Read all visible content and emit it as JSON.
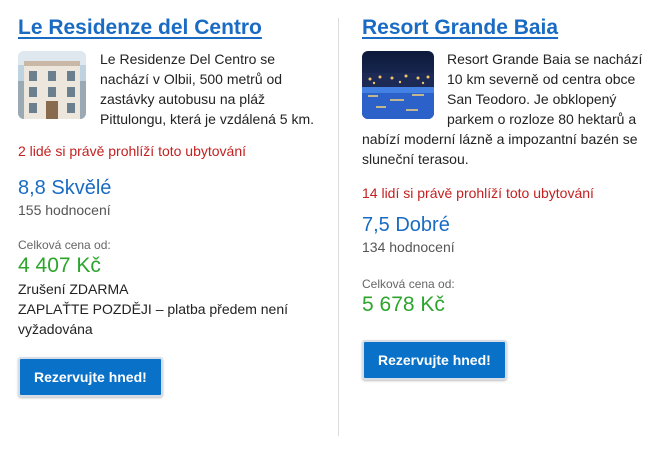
{
  "button_color": "#0a71c9",
  "link_color": "#1a6bc4",
  "viewer_color": "#c42020",
  "price_color": "#2da52d",
  "hotels": [
    {
      "name": "Le Residenze del Centro",
      "description": "Le Residenze Del Centro se nachází v Olbii, 500 metrů od zastávky autobusu na pláž Pittulongu, která je vzdálená 5 km.",
      "viewers": "2 lidé si právě prohlíží toto ubytování",
      "score": "8,8 Skvělé",
      "reviews": "155 hodnocení",
      "price_label": "Celková cena od:",
      "price": "4 407 Kč",
      "cancellation": "Zrušení ZDARMA",
      "payment": "ZAPLAŤTE POZDĚJI – platba předem není vyžadována",
      "button": "Rezervujte hned!"
    },
    {
      "name": "Resort Grande Baia",
      "description": "Resort Grande Baia se nachází 10 km severně od centra obce San Teodoro. Je obklopený parkem o rozloze 80 hektarů a nabízí moderní lázně a impozantní bazén se sluneční terasou.",
      "viewers": "14 lidí si právě prohlíží toto ubytování",
      "score": "7,5 Dobré",
      "reviews": "134 hodnocení",
      "price_label": "Celková cena od:",
      "price": "5 678 Kč",
      "button": "Rezervujte hned!"
    }
  ]
}
